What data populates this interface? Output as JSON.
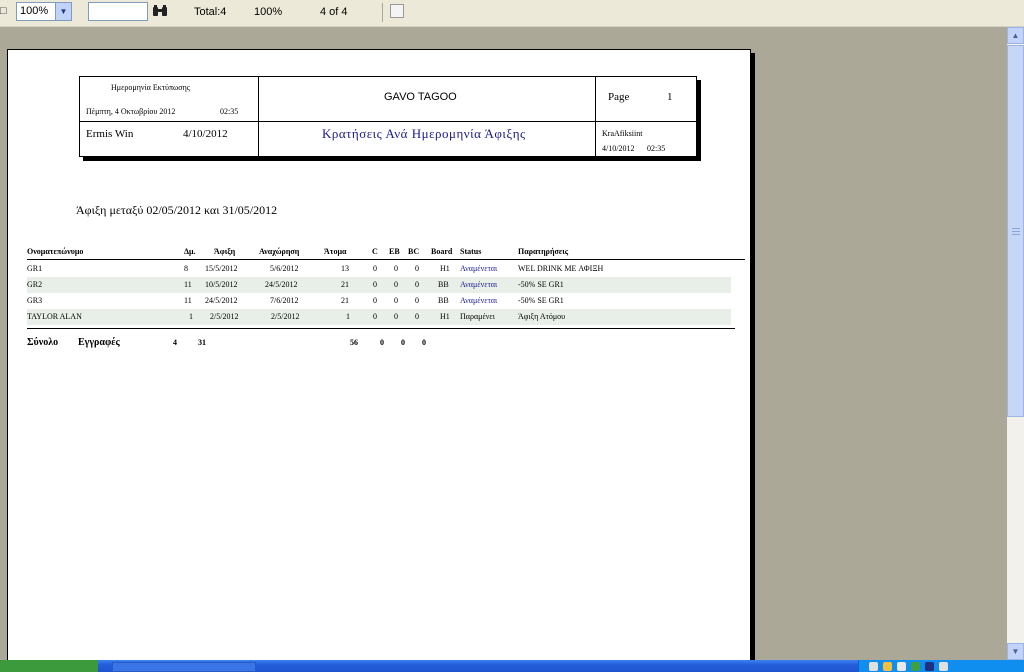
{
  "toolbar": {
    "zoom_value": "100%",
    "search_value": "",
    "total_label": "Total:4",
    "percent_label": "100%",
    "page_label": "4 of 4"
  },
  "report": {
    "print_date_label": "Ημερομηνία Εκτύπωσης",
    "print_date": "Πέμπτη, 4 Οκτωβρίου 2012",
    "print_time": "02:35",
    "company": "GAVO TAGOO",
    "page_label": "Page",
    "page_number": "1",
    "user": "Ermis Win",
    "user_date": "4/10/2012",
    "title": "Κρατήσεις Ανά Ημερομηνία Άφιξης",
    "report_code": "KraAfiksiint",
    "report_date": "4/10/2012",
    "report_time": "02:35",
    "range_text": "Άφιξη μεταξύ 02/05/2012 και 31/05/2012"
  },
  "table": {
    "headers": {
      "name": "Ονοματεπώνυμο",
      "rooms": "Δμ.",
      "arrival": "Άφιξη",
      "departure": "Αναχώρηση",
      "persons": "Άτομα",
      "c": "C",
      "eb": "EB",
      "bc": "BC",
      "board": "Board",
      "status": "Status",
      "notes": "Παρατηρήσεις"
    },
    "rows": [
      {
        "name": "GR1",
        "rooms": "8",
        "arrival": "15/5/2012",
        "departure": "5/6/2012",
        "persons": "13",
        "c": "0",
        "eb": "0",
        "bc": "0",
        "board": "H1",
        "status": "Αναμένεται",
        "notes": "WEL DRINK ME ΑΦΙΞΗ"
      },
      {
        "name": "GR2",
        "rooms": "11",
        "arrival": "10/5/2012",
        "departure": "24/5/2012",
        "persons": "21",
        "c": "0",
        "eb": "0",
        "bc": "0",
        "board": "BB",
        "status": "Αναμένεται",
        "notes": "-50% SE GR1"
      },
      {
        "name": "GR3",
        "rooms": "11",
        "arrival": "24/5/2012",
        "departure": "7/6/2012",
        "persons": "21",
        "c": "0",
        "eb": "0",
        "bc": "0",
        "board": "BB",
        "status": "Αναμένεται",
        "notes": "-50% SE GR1"
      },
      {
        "name": "TAYLOR ALAN",
        "rooms": "1",
        "arrival": "2/5/2012",
        "departure": "2/5/2012",
        "persons": "1",
        "c": "0",
        "eb": "0",
        "bc": "0",
        "board": "H1",
        "status": "Παραμένει",
        "notes": "Άφιξη Ατόμου"
      }
    ],
    "totals": {
      "label1": "Σύνολο",
      "label2": "Εγγραφές",
      "records": "4",
      "rooms": "31",
      "persons": "56",
      "c": "0",
      "eb": "0",
      "bc": "0"
    }
  },
  "colors": {
    "accent": "#1a1a8c",
    "row_alt": "#e8efe8"
  }
}
